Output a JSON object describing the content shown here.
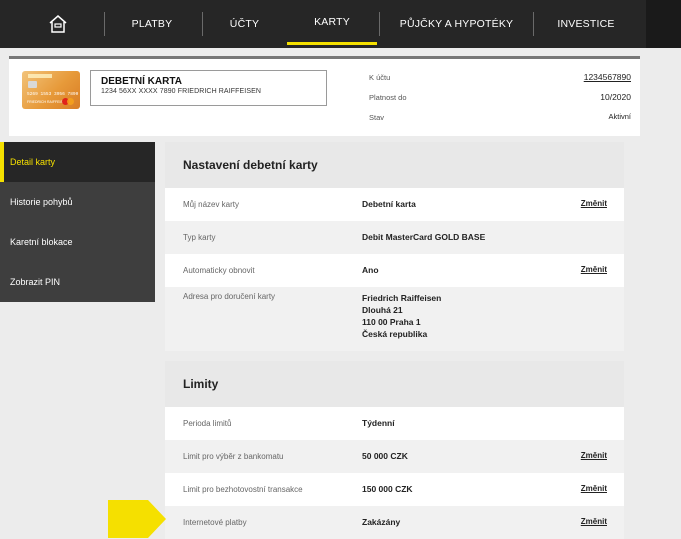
{
  "nav": {
    "items": [
      "PLATBY",
      "ÚČTY",
      "KARTY",
      "PŮJČKY A HYPOTÉKY",
      "INVESTICE"
    ],
    "active": "KARTY"
  },
  "card": {
    "image_number": "5269 1553 3956 7890",
    "image_holder": "FRIEDRICH RAIFFEISEN",
    "title": "DEBETNÍ KARTA",
    "subtitle": "1234 56XX XXXX 7890  FRIEDRICH RAIFFEISEN",
    "account_label": "K účtu",
    "account_value": "1234567890",
    "validity_label": "Platnost do",
    "validity_value": "10/2020",
    "status_label": "Stav",
    "status_value": "Aktivní"
  },
  "sidebar": {
    "items": [
      "Detail karty",
      "Historie pohybů",
      "Karetní blokace",
      "Zobrazit PIN"
    ]
  },
  "settings": {
    "title": "Nastavení debetní karty",
    "rows": [
      {
        "label": "Můj název karty",
        "value": "Debetní karta",
        "action": "Změnit"
      },
      {
        "label": "Typ karty",
        "value": "Debit MasterCard GOLD BASE",
        "action": ""
      },
      {
        "label": "Automaticky obnovit",
        "value": "Ano",
        "action": "Změnit"
      }
    ],
    "address_label": "Adresa pro doručení karty",
    "address_lines": [
      "Friedrich Raiffeisen",
      "Dlouhá 21",
      "110 00 Praha 1",
      "Česká republika"
    ]
  },
  "limits": {
    "title": "Limity",
    "rows": [
      {
        "label": "Perioda limitů",
        "value": "Týdenní",
        "action": ""
      },
      {
        "label": "Limit pro výběr z bankomatu",
        "value": "50 000 CZK",
        "action": "Změnit"
      },
      {
        "label": "Limit pro bezhotovostní transakce",
        "value": "150 000 CZK",
        "action": "Změnit"
      },
      {
        "label": "Internetové platby",
        "value": "Zakázány",
        "action": "Změnit"
      }
    ]
  },
  "colors": {
    "accent": "#f5e000",
    "nav_bg": "#262626",
    "sidebar_bg": "#3e3e3e"
  }
}
